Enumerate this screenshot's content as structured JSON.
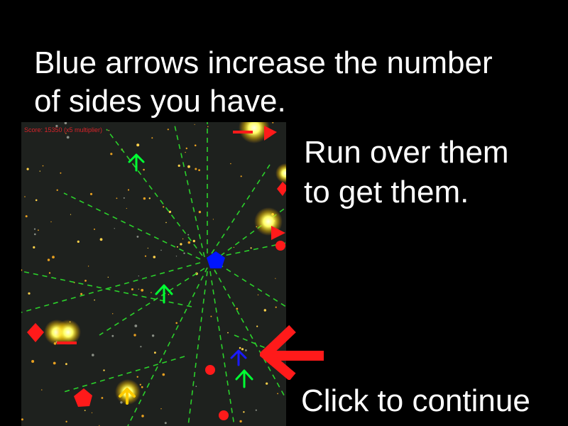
{
  "instructions": {
    "line1": "Blue arrows increase the number",
    "line2": "of sides you have.",
    "run1": "Run over them",
    "run2": "to get them."
  },
  "continue_label": "Click to continue",
  "game": {
    "score_text": "Score: 15350 (x5 multiplier)"
  },
  "icons": {
    "pointer": "red-left-arrow-icon",
    "player": "blue-pentagon-icon",
    "powerup": "blue-arrow-icon",
    "pickup": "green-arrow-icon"
  },
  "colors": {
    "background": "#000000",
    "text": "#ffffff",
    "game_bg": "#1e211e",
    "player": "#0015ff",
    "blue_arrow": "#1a1aff",
    "green_arrow": "#00ff33",
    "enemy": "#ff1a1a",
    "dash": "#2bd12b",
    "glow": "#ffff66"
  }
}
